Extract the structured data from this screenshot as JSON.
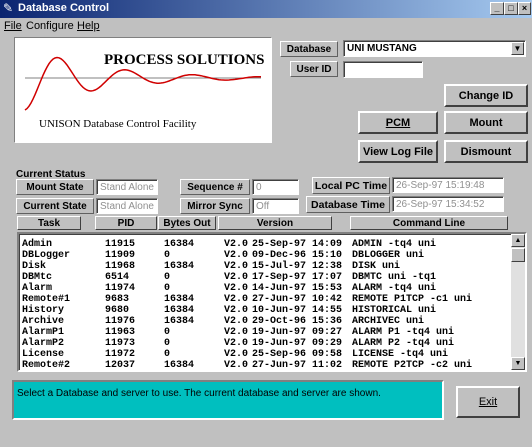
{
  "window": {
    "title": "Database Control",
    "icon": "app-icon"
  },
  "menu": [
    {
      "label": "File"
    },
    {
      "label": "Configure"
    },
    {
      "label": "Help"
    }
  ],
  "logo": {
    "title": "PROCESS SOLUTIONS",
    "subtitle": "UNISON Database Control Facility",
    "curve_color": "#d00000"
  },
  "top": {
    "database_label": "Database",
    "database_value": "UNI   MUSTANG",
    "userid_label": "User ID",
    "userid_value": "",
    "change_id": "Change ID",
    "pcm": "PCM",
    "mount": "Mount",
    "view_log": "View Log File",
    "dismount": "Dismount"
  },
  "status": {
    "section_title": "Current Status",
    "mount_state_label": "Mount State",
    "mount_state_value": "Stand Alone",
    "current_state_label": "Current State",
    "current_state_value": "Stand Alone",
    "sequence_label": "Sequence #",
    "sequence_value": "0",
    "mirror_sync_label": "Mirror Sync",
    "mirror_sync_value": "Off",
    "local_pc_time_label": "Local PC Time",
    "local_pc_time_value": "26-Sep-97 15:19:48",
    "database_time_label": "Database Time",
    "database_time_value": "26-Sep-97 15:34:52"
  },
  "columns": {
    "task": "Task",
    "pid": "PID",
    "bytes_out": "Bytes Out",
    "version": "Version",
    "command_line": "Command Line"
  },
  "tasks": [
    {
      "task": "Admin",
      "pid": "11915",
      "bytes": "16384",
      "ver": "V2.0",
      "date": "25-Sep-97",
      "time": "14:09",
      "cmd": "ADMIN -tq4 uni"
    },
    {
      "task": "DBLogger",
      "pid": "11909",
      "bytes": "0",
      "ver": "V2.0",
      "date": "09-Dec-96",
      "time": "15:10",
      "cmd": "DBLOGGER uni"
    },
    {
      "task": "Disk",
      "pid": "11968",
      "bytes": "16384",
      "ver": "V2.0",
      "date": "15-Jul-97",
      "time": "12:38",
      "cmd": "DISK uni"
    },
    {
      "task": "DBMtc",
      "pid": "6514",
      "bytes": "0",
      "ver": "V2.0",
      "date": "17-Sep-97",
      "time": "17:07",
      "cmd": "DBMTC uni -tq1"
    },
    {
      "task": "Alarm",
      "pid": "11974",
      "bytes": "0",
      "ver": "V2.0",
      "date": "14-Jun-97",
      "time": "15:53",
      "cmd": "ALARM -tq4 uni"
    },
    {
      "task": "Remote#1",
      "pid": "9683",
      "bytes": "16384",
      "ver": "V2.0",
      "date": "27-Jun-97",
      "time": "10:42",
      "cmd": "REMOTE P1TCP -c1 uni"
    },
    {
      "task": "History",
      "pid": "9680",
      "bytes": "16384",
      "ver": "V2.0",
      "date": "10-Jun-97",
      "time": "14:55",
      "cmd": "HISTORICAL uni"
    },
    {
      "task": "Archive",
      "pid": "11976",
      "bytes": "16384",
      "ver": "V2.0",
      "date": "29-Oct-96",
      "time": "15:36",
      "cmd": "ARCHIVEC uni"
    },
    {
      "task": "AlarmP1",
      "pid": "11963",
      "bytes": "0",
      "ver": "V2.0",
      "date": "19-Jun-97",
      "time": "09:27",
      "cmd": "ALARM P1 -tq4 uni"
    },
    {
      "task": "AlarmP2",
      "pid": "11973",
      "bytes": "0",
      "ver": "V2.0",
      "date": "19-Jun-97",
      "time": "09:29",
      "cmd": "ALARM P2 -tq4 uni"
    },
    {
      "task": "License",
      "pid": "11972",
      "bytes": "0",
      "ver": "V2.0",
      "date": "25-Sep-96",
      "time": "09:58",
      "cmd": "LICENSE -tq4 uni"
    },
    {
      "task": "Remote#2",
      "pid": "12037",
      "bytes": "16384",
      "ver": "V2.0",
      "date": "27-Jun-97",
      "time": "11:02",
      "cmd": "REMOTE P2TCP -c2 uni"
    }
  ],
  "statusbar": {
    "message": "Select a Database and server to use. The current database and server are shown.",
    "color": "#00bfbf"
  },
  "exit": "Exit"
}
